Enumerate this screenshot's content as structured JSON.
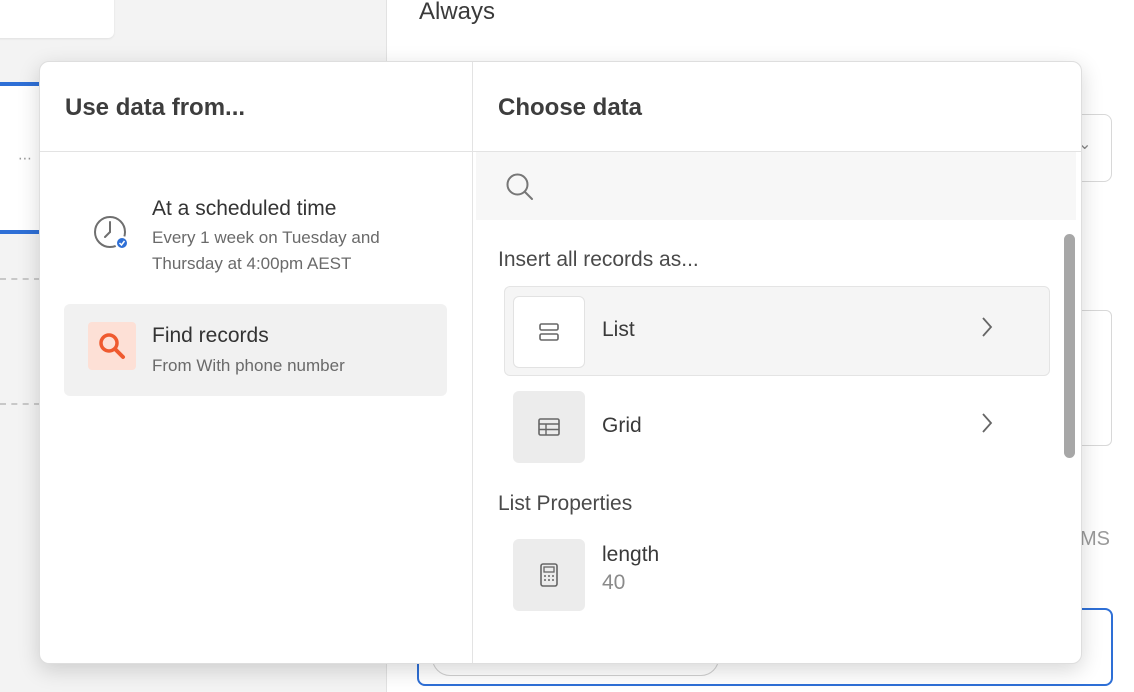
{
  "background": {
    "trigger_label": "Always",
    "units_suffix": "MS"
  },
  "source_panel": {
    "title": "Use data from...",
    "items": [
      {
        "title": "At a scheduled time",
        "subtitle": "Every 1 week on Tuesday and Thursday at 4:00pm AEST",
        "icon": "clock-icon"
      },
      {
        "title": "Find records",
        "subtitle": "From With phone number",
        "icon": "search-icon"
      }
    ]
  },
  "data_panel": {
    "title": "Choose data",
    "search": {
      "placeholder": "",
      "value": ""
    },
    "insert_section_label": "Insert all records as...",
    "insert_options": [
      {
        "label": "List",
        "icon": "list-icon"
      },
      {
        "label": "Grid",
        "icon": "grid-icon"
      }
    ],
    "properties_section_label": "List Properties",
    "properties": [
      {
        "name": "length",
        "value": "40",
        "icon": "calculator-icon"
      }
    ]
  },
  "colors": {
    "accent": "#2e6fd6",
    "find_records_icon": "#ef5a2f",
    "find_records_icon_bg": "#fde0d6"
  }
}
